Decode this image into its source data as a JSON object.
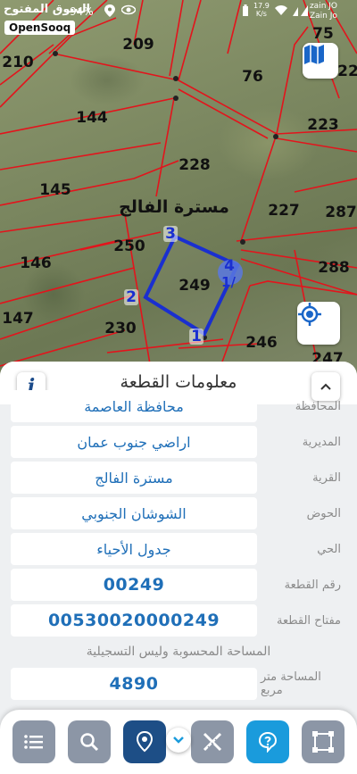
{
  "status_bar": {
    "left_text": "السوق المفتوح",
    "battery_percent": "94%",
    "speed_value": "17.9",
    "speed_unit": "K/s",
    "carrier_1": "zain JO",
    "carrier_2": "Zain Jo"
  },
  "brand": "OpenSooq",
  "map": {
    "village_label": "مسترة الفالج",
    "plot_numbers": [
      "209",
      "75",
      "210",
      "22",
      "76",
      "144",
      "223",
      "228",
      "145",
      "227",
      "287",
      "250",
      "146",
      "249",
      "288",
      "147",
      "230",
      "246",
      "247"
    ],
    "selected_plot": "249",
    "vertex_labels": [
      "1",
      "2",
      "3",
      "4"
    ],
    "extra_label": "1/",
    "selected_color": "#1a2fd0",
    "parcel_line_color": "#e3141c"
  },
  "panel": {
    "title": "معلومات القطعة",
    "info_icon_text": "i",
    "rows": [
      {
        "label": "المحافظة",
        "value": "محافظة العاصمة"
      },
      {
        "label": "المديرية",
        "value": "اراضي جنوب عمان"
      },
      {
        "label": "القرية",
        "value": "مسترة الفالج"
      },
      {
        "label": "الحوض",
        "value": "الشوشان الجنوبي"
      },
      {
        "label": "الحي",
        "value": "جدول الأحياء"
      },
      {
        "label": "رقم القطعة",
        "value": "00249"
      },
      {
        "label": "مفتاح القطعة",
        "value": "00530020000249"
      }
    ],
    "section_note": "المساحة المحسوبة وليس التسجيلية",
    "area": {
      "label": "المساحة متر مربع",
      "value": "4890"
    }
  },
  "toolbar": {
    "buttons": [
      "menu-icon",
      "search-icon",
      "location-pin-icon",
      "measure-icon",
      "help-icon",
      "polygon-icon"
    ]
  }
}
